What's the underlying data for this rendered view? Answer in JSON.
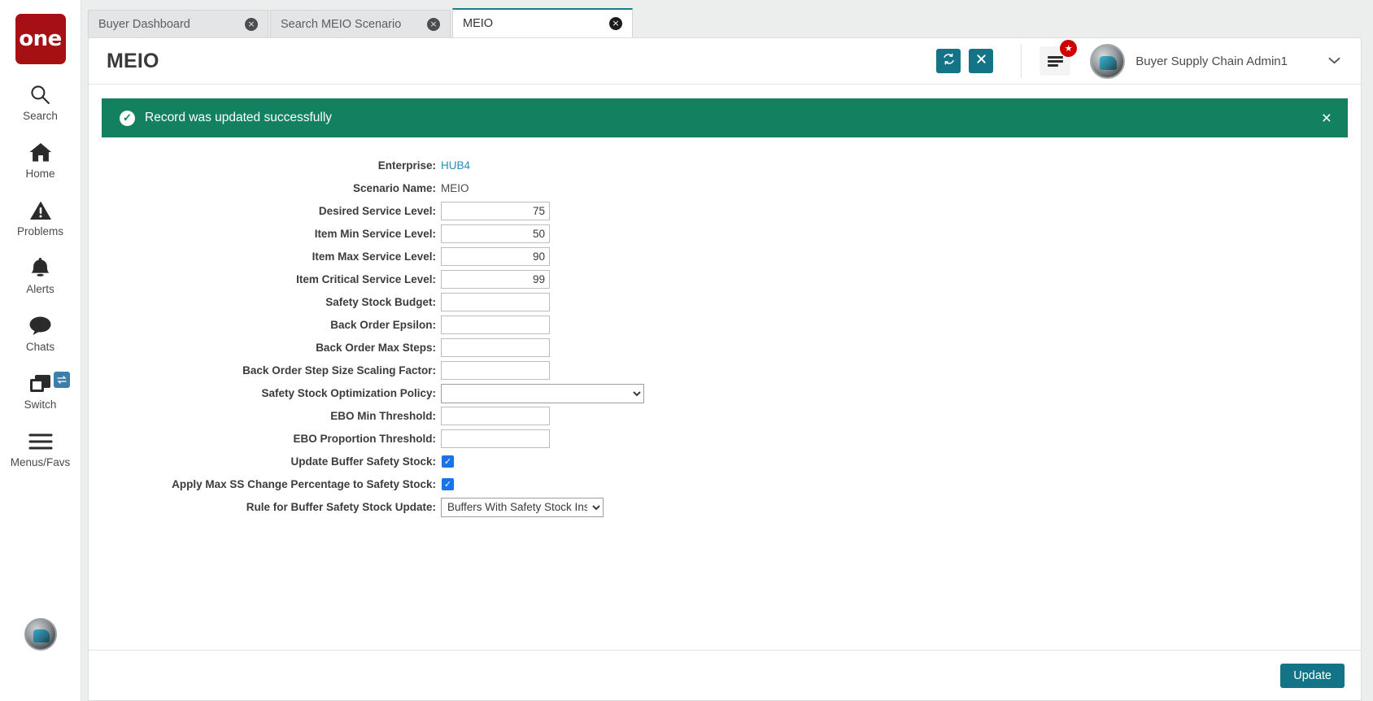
{
  "colors": {
    "brand_red": "#a60f14",
    "teal": "#147387",
    "success_green": "#13805f",
    "link_blue": "#2a8bb5",
    "checkbox_blue": "#1a73e8",
    "active_tab_border": "#1a7f8e"
  },
  "rail": {
    "logo_text": "one",
    "items": [
      {
        "label": "Search",
        "icon": "search-icon"
      },
      {
        "label": "Home",
        "icon": "home-icon"
      },
      {
        "label": "Problems",
        "icon": "warning-triangle-icon"
      },
      {
        "label": "Alerts",
        "icon": "bell-icon"
      },
      {
        "label": "Chats",
        "icon": "chat-bubble-icon"
      },
      {
        "label": "Switch",
        "icon": "switch-windows-icon",
        "badge_icon": "swap-arrows-icon"
      },
      {
        "label": "Menus/Favs",
        "icon": "hamburger-icon"
      }
    ]
  },
  "tabs": [
    {
      "label": "Buyer Dashboard",
      "active": false,
      "close_icon": "close-circle-icon"
    },
    {
      "label": "Search MEIO Scenario",
      "active": false,
      "close_icon": "close-circle-icon"
    },
    {
      "label": "MEIO",
      "active": true,
      "close_icon": "close-circle-icon"
    }
  ],
  "header": {
    "title": "MEIO",
    "refresh_icon": "refresh-icon",
    "close_icon": "close-icon",
    "menu_icon": "hamburger-menu-icon",
    "menu_badge_icon": "star-icon",
    "avatar_icon": "user-avatar",
    "username": "Buyer Supply Chain Admin1",
    "caret_icon": "chevron-down-icon"
  },
  "banner": {
    "icon": "check-circle-icon",
    "message": "Record was updated successfully",
    "dismiss_icon": "close-icon"
  },
  "form": {
    "fields": [
      {
        "label": "Enterprise:",
        "type": "link",
        "value": "HUB4"
      },
      {
        "label": "Scenario Name:",
        "type": "text",
        "value": "MEIO"
      },
      {
        "label": "Desired Service Level:",
        "type": "input",
        "value": "75"
      },
      {
        "label": "Item Min Service Level:",
        "type": "input",
        "value": "50"
      },
      {
        "label": "Item Max Service Level:",
        "type": "input",
        "value": "90"
      },
      {
        "label": "Item Critical Service Level:",
        "type": "input",
        "value": "99"
      },
      {
        "label": "Safety Stock Budget:",
        "type": "input",
        "value": ""
      },
      {
        "label": "Back Order Epsilon:",
        "type": "input",
        "value": ""
      },
      {
        "label": "Back Order Max Steps:",
        "type": "input",
        "value": ""
      },
      {
        "label": "Back Order Step Size Scaling Factor:",
        "type": "input",
        "value": ""
      },
      {
        "label": "Safety Stock Optimization Policy:",
        "type": "select",
        "value": "",
        "variant": "policy"
      },
      {
        "label": "EBO Min Threshold:",
        "type": "input",
        "value": ""
      },
      {
        "label": "EBO Proportion Threshold:",
        "type": "input",
        "value": ""
      },
      {
        "label": "Update Buffer Safety Stock:",
        "type": "checkbox",
        "value": "checked"
      },
      {
        "label": "Apply Max SS Change Percentage to Safety Stock:",
        "type": "checkbox",
        "value": "checked"
      },
      {
        "label": "Rule for Buffer Safety Stock Update:",
        "type": "select",
        "value": "Buffers With Safety Stock Inside",
        "variant": "rule"
      }
    ]
  },
  "footer": {
    "update_label": "Update"
  }
}
